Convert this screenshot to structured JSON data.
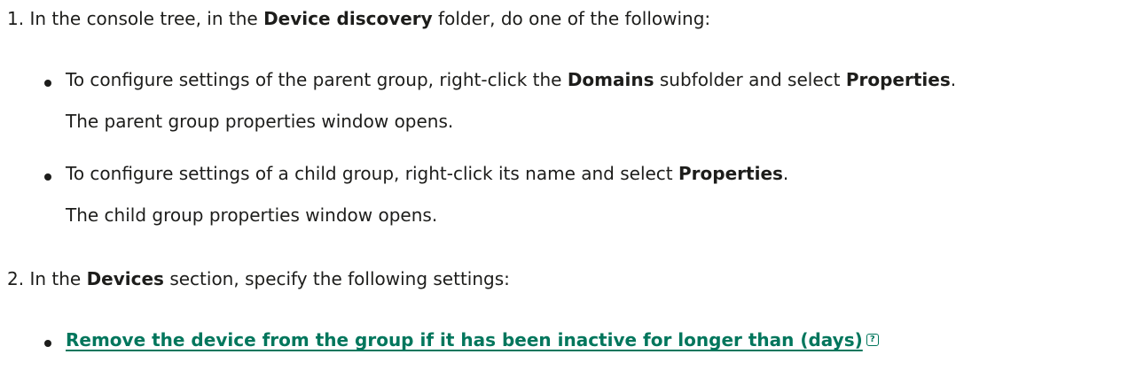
{
  "steps": [
    {
      "number": "1.",
      "pre": "In the console tree, in the ",
      "bold": "Device discovery",
      "post": " folder, do one of the following:",
      "bullets": [
        {
          "pre": "To configure settings of the parent group, right-click the ",
          "bold1": "Domains",
          "mid": " subfolder and select ",
          "bold2": "Properties",
          "post": ".",
          "result": "The parent group properties window opens."
        },
        {
          "pre": "To configure settings of a child group, right-click its name and select ",
          "bold": "Properties",
          "post": ".",
          "result": "The child group properties window opens."
        }
      ]
    },
    {
      "number": "2.",
      "pre": "In the ",
      "bold": "Devices",
      "post": " section, specify the following settings:",
      "link_bullet": {
        "label": "Remove the device from the group if it has been inactive for longer than (days)",
        "help_glyph": "?"
      }
    }
  ],
  "colors": {
    "text": "#1d1d1b",
    "link": "#00765c"
  }
}
